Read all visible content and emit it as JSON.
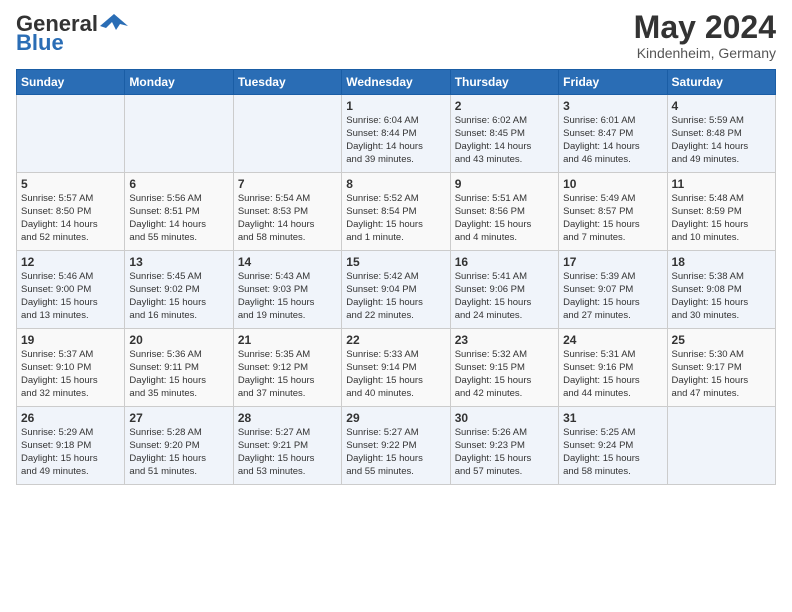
{
  "header": {
    "logo_general": "General",
    "logo_blue": "Blue",
    "month": "May 2024",
    "location": "Kindenheim, Germany"
  },
  "weekdays": [
    "Sunday",
    "Monday",
    "Tuesday",
    "Wednesday",
    "Thursday",
    "Friday",
    "Saturday"
  ],
  "weeks": [
    [
      {
        "day": "",
        "info": ""
      },
      {
        "day": "",
        "info": ""
      },
      {
        "day": "",
        "info": ""
      },
      {
        "day": "1",
        "info": "Sunrise: 6:04 AM\nSunset: 8:44 PM\nDaylight: 14 hours\nand 39 minutes."
      },
      {
        "day": "2",
        "info": "Sunrise: 6:02 AM\nSunset: 8:45 PM\nDaylight: 14 hours\nand 43 minutes."
      },
      {
        "day": "3",
        "info": "Sunrise: 6:01 AM\nSunset: 8:47 PM\nDaylight: 14 hours\nand 46 minutes."
      },
      {
        "day": "4",
        "info": "Sunrise: 5:59 AM\nSunset: 8:48 PM\nDaylight: 14 hours\nand 49 minutes."
      }
    ],
    [
      {
        "day": "5",
        "info": "Sunrise: 5:57 AM\nSunset: 8:50 PM\nDaylight: 14 hours\nand 52 minutes."
      },
      {
        "day": "6",
        "info": "Sunrise: 5:56 AM\nSunset: 8:51 PM\nDaylight: 14 hours\nand 55 minutes."
      },
      {
        "day": "7",
        "info": "Sunrise: 5:54 AM\nSunset: 8:53 PM\nDaylight: 14 hours\nand 58 minutes."
      },
      {
        "day": "8",
        "info": "Sunrise: 5:52 AM\nSunset: 8:54 PM\nDaylight: 15 hours\nand 1 minute."
      },
      {
        "day": "9",
        "info": "Sunrise: 5:51 AM\nSunset: 8:56 PM\nDaylight: 15 hours\nand 4 minutes."
      },
      {
        "day": "10",
        "info": "Sunrise: 5:49 AM\nSunset: 8:57 PM\nDaylight: 15 hours\nand 7 minutes."
      },
      {
        "day": "11",
        "info": "Sunrise: 5:48 AM\nSunset: 8:59 PM\nDaylight: 15 hours\nand 10 minutes."
      }
    ],
    [
      {
        "day": "12",
        "info": "Sunrise: 5:46 AM\nSunset: 9:00 PM\nDaylight: 15 hours\nand 13 minutes."
      },
      {
        "day": "13",
        "info": "Sunrise: 5:45 AM\nSunset: 9:02 PM\nDaylight: 15 hours\nand 16 minutes."
      },
      {
        "day": "14",
        "info": "Sunrise: 5:43 AM\nSunset: 9:03 PM\nDaylight: 15 hours\nand 19 minutes."
      },
      {
        "day": "15",
        "info": "Sunrise: 5:42 AM\nSunset: 9:04 PM\nDaylight: 15 hours\nand 22 minutes."
      },
      {
        "day": "16",
        "info": "Sunrise: 5:41 AM\nSunset: 9:06 PM\nDaylight: 15 hours\nand 24 minutes."
      },
      {
        "day": "17",
        "info": "Sunrise: 5:39 AM\nSunset: 9:07 PM\nDaylight: 15 hours\nand 27 minutes."
      },
      {
        "day": "18",
        "info": "Sunrise: 5:38 AM\nSunset: 9:08 PM\nDaylight: 15 hours\nand 30 minutes."
      }
    ],
    [
      {
        "day": "19",
        "info": "Sunrise: 5:37 AM\nSunset: 9:10 PM\nDaylight: 15 hours\nand 32 minutes."
      },
      {
        "day": "20",
        "info": "Sunrise: 5:36 AM\nSunset: 9:11 PM\nDaylight: 15 hours\nand 35 minutes."
      },
      {
        "day": "21",
        "info": "Sunrise: 5:35 AM\nSunset: 9:12 PM\nDaylight: 15 hours\nand 37 minutes."
      },
      {
        "day": "22",
        "info": "Sunrise: 5:33 AM\nSunset: 9:14 PM\nDaylight: 15 hours\nand 40 minutes."
      },
      {
        "day": "23",
        "info": "Sunrise: 5:32 AM\nSunset: 9:15 PM\nDaylight: 15 hours\nand 42 minutes."
      },
      {
        "day": "24",
        "info": "Sunrise: 5:31 AM\nSunset: 9:16 PM\nDaylight: 15 hours\nand 44 minutes."
      },
      {
        "day": "25",
        "info": "Sunrise: 5:30 AM\nSunset: 9:17 PM\nDaylight: 15 hours\nand 47 minutes."
      }
    ],
    [
      {
        "day": "26",
        "info": "Sunrise: 5:29 AM\nSunset: 9:18 PM\nDaylight: 15 hours\nand 49 minutes."
      },
      {
        "day": "27",
        "info": "Sunrise: 5:28 AM\nSunset: 9:20 PM\nDaylight: 15 hours\nand 51 minutes."
      },
      {
        "day": "28",
        "info": "Sunrise: 5:27 AM\nSunset: 9:21 PM\nDaylight: 15 hours\nand 53 minutes."
      },
      {
        "day": "29",
        "info": "Sunrise: 5:27 AM\nSunset: 9:22 PM\nDaylight: 15 hours\nand 55 minutes."
      },
      {
        "day": "30",
        "info": "Sunrise: 5:26 AM\nSunset: 9:23 PM\nDaylight: 15 hours\nand 57 minutes."
      },
      {
        "day": "31",
        "info": "Sunrise: 5:25 AM\nSunset: 9:24 PM\nDaylight: 15 hours\nand 58 minutes."
      },
      {
        "day": "",
        "info": ""
      }
    ]
  ]
}
